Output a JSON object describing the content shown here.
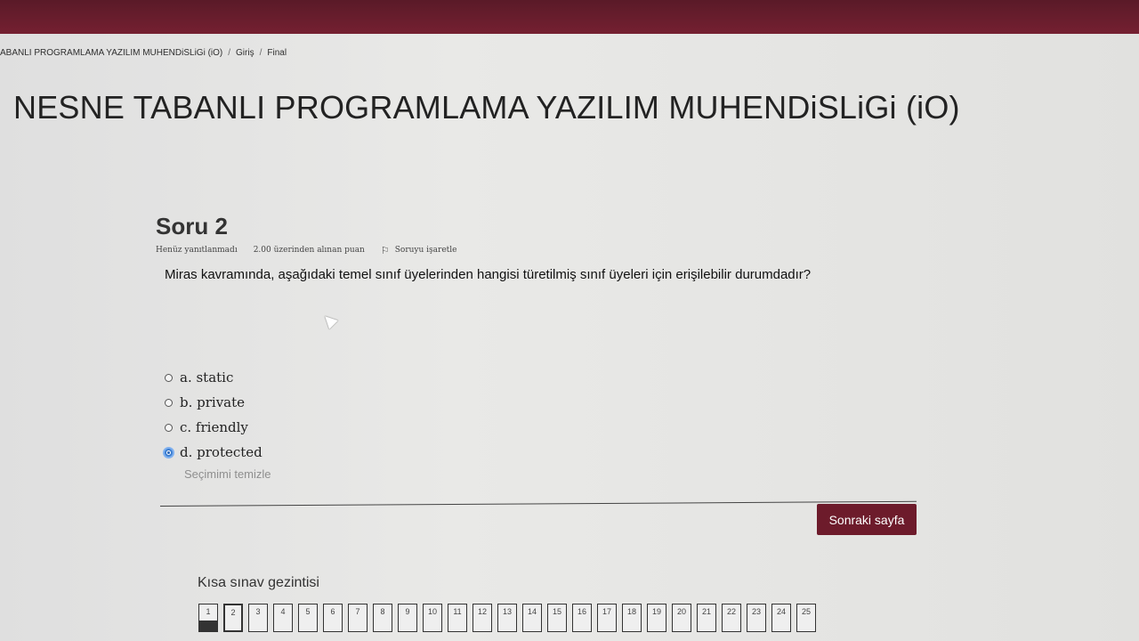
{
  "breadcrumb": {
    "course": "ABANLI PROGRAMLAMA YAZILIM MUHENDiSLiGi (iO)",
    "home": "Giriş",
    "final": "Final"
  },
  "course_title": "NESNE TABANLI PROGRAMLAMA YAZILIM MUHENDiSLiGi (iO)",
  "question": {
    "title": "Soru 2",
    "status": "Henüz yanıtlanmadı",
    "score": "2.00 üzerinden alınan puan",
    "flag_label": "Soruyu işaretle",
    "text": "Miras kavramında, aşağıdaki temel sınıf üyelerinden hangisi türetilmiş sınıf üyeleri için erişilebilir durumdadır?",
    "options": [
      {
        "label": "a. static",
        "selected": false
      },
      {
        "label": "b. private",
        "selected": false
      },
      {
        "label": "c. friendly",
        "selected": false
      },
      {
        "label": "d. protected",
        "selected": true
      }
    ],
    "clear_selection": "Seçimimi temizle"
  },
  "next_button": "Sonraki sayfa",
  "quiz_nav": {
    "title": "Kısa sınav gezintisi",
    "items": [
      "1",
      "2",
      "3",
      "4",
      "5",
      "6",
      "7",
      "8",
      "9",
      "10",
      "11",
      "12",
      "13",
      "14",
      "15",
      "16",
      "17",
      "18",
      "19",
      "20",
      "21",
      "22",
      "23",
      "24",
      "25"
    ]
  },
  "colors": {
    "topbar": "#7a2133",
    "accent_button": "#6d1b2b",
    "radio_selected": "#3d7fd1"
  }
}
